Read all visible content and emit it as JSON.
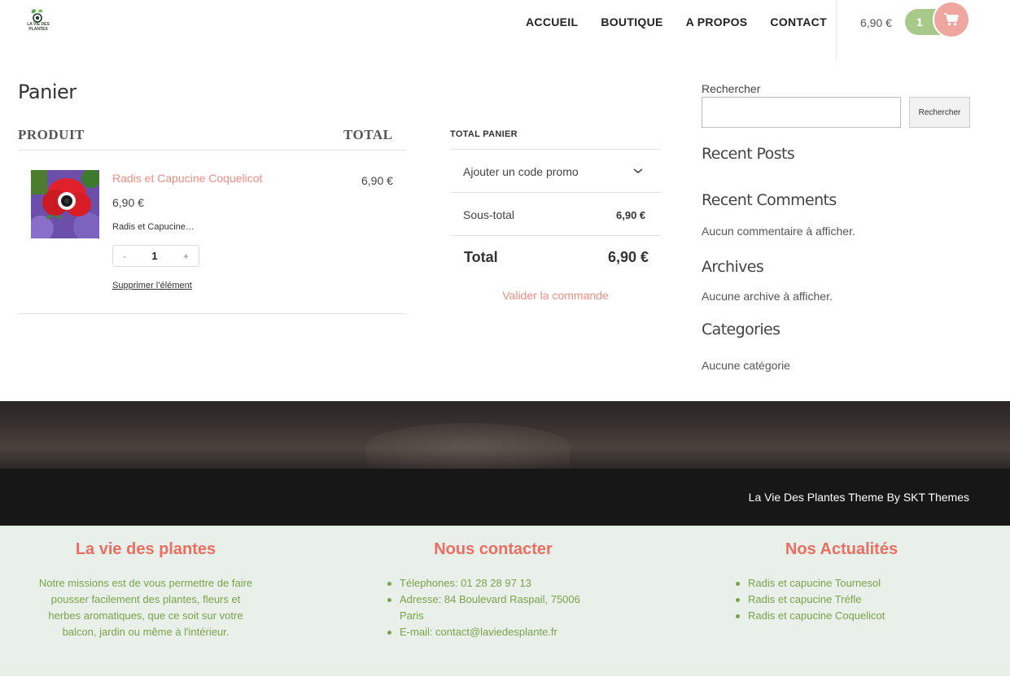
{
  "header": {
    "logo_text": "LA VIE DES PLANTES",
    "nav": [
      "ACCUEIL",
      "BOUTIQUE",
      "A PROPOS",
      "CONTACT"
    ],
    "cart_price": "6,90 €",
    "cart_count": "1",
    "cart_icon": "cart-icon"
  },
  "cart": {
    "title": "Panier",
    "col_product": "PRODUIT",
    "col_total": "TOTAL",
    "item": {
      "name": "Radis et Capucine Coquelicot",
      "price": "6,90 €",
      "description": "Radis et Capucine…",
      "qty_minus": "-",
      "qty_value": "1",
      "qty_plus": "+",
      "remove": "Supprimer l’élément",
      "total": "6,90 €"
    }
  },
  "totals": {
    "heading": "TOTAL PANIER",
    "promo": "Ajouter un code promo",
    "subtotal_label": "Sous-total",
    "subtotal_value": "6,90 €",
    "total_label": "Total",
    "total_value": "6,90 €",
    "checkout": "Valider la commande"
  },
  "sidebar": {
    "search_label": "Rechercher",
    "search_button": "Rechercher",
    "recent_posts": "Recent Posts",
    "recent_comments": "Recent Comments",
    "no_comments": "Aucun commentaire à afficher.",
    "archives": "Archives",
    "no_archives": "Aucune archive à afficher.",
    "categories": "Categories",
    "no_categories": "Aucune catégorie"
  },
  "credit": "La Vie Des Plantes Theme By SKT Themes",
  "footer": {
    "col1_title": "La vie des plantes",
    "col1_text": "Notre missions est de vous permettre de faire pousser facilement des plantes, fleurs et herbes aromatiques, que ce soit sur votre balcon, jardin ou même à l'intérieur.",
    "col2_title": "Nous contacter",
    "col2_items": [
      "Télephones: 01 28 28 97 13",
      "Adresse: 84 Boulevard Raspail, 75006 Paris",
      "E-mail: contact@laviedesplante.fr"
    ],
    "col3_title": "Nos Actualités",
    "col3_items": [
      "Radis et capucine Tournesol",
      "Radis et capucine Tréfle",
      "Radis et capucine Coquelicot"
    ]
  },
  "colors": {
    "accent_pink": "#f28b82",
    "cart_green": "#a8c98a",
    "footer_title": "#ec6e62",
    "footer_text": "#7aa34a"
  }
}
